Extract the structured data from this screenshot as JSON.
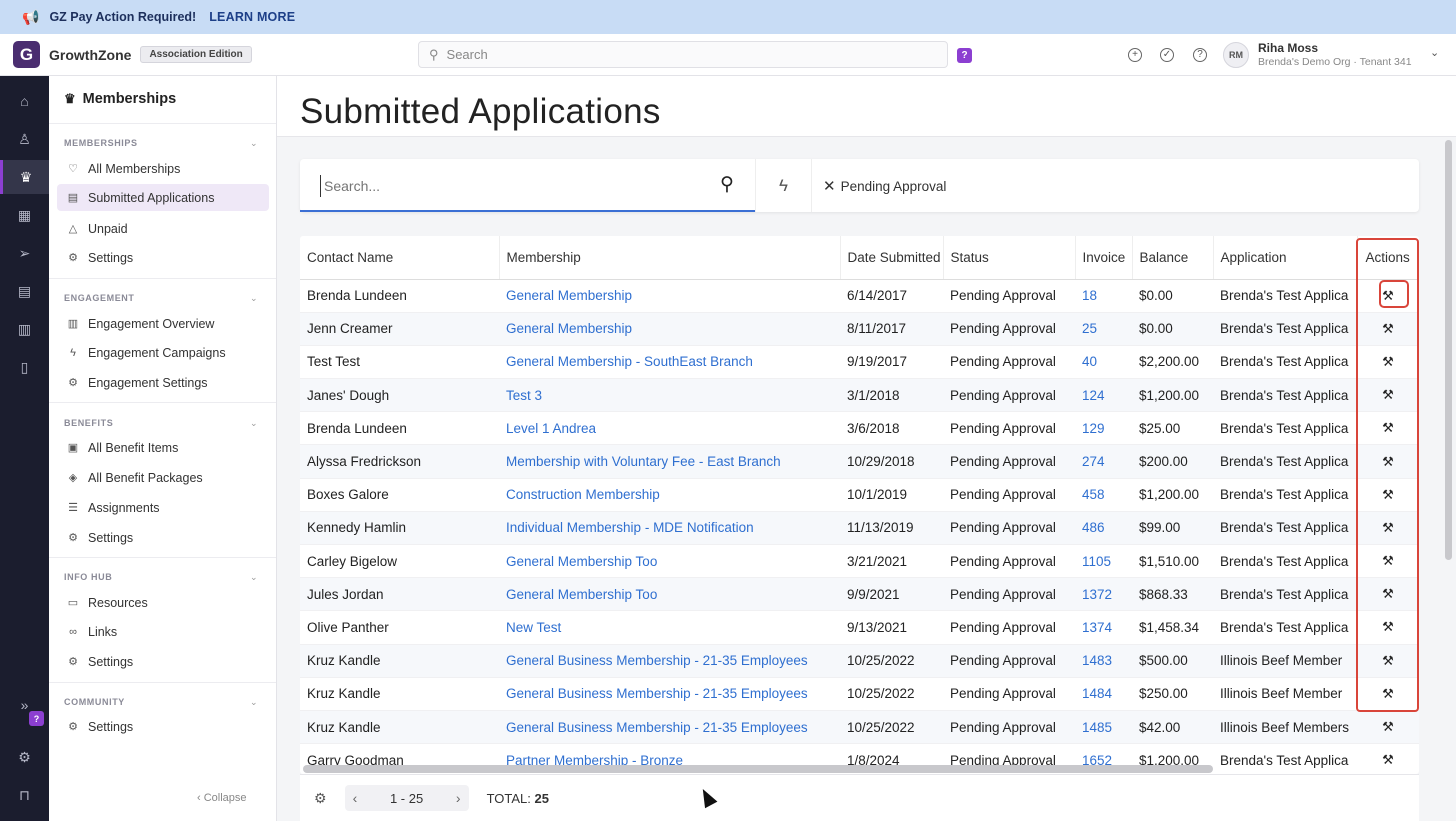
{
  "banner": {
    "text": "GZ Pay Action Required!",
    "link": "LEARN MORE"
  },
  "topbar": {
    "logo": "G",
    "brand": "GrowthZone",
    "edition": "Association Edition",
    "search_placeholder": "Search",
    "help_badge": "?",
    "user_initials": "RM",
    "user_name": "Riha Moss",
    "user_org": "Brenda's Demo Org · Tenant 341"
  },
  "rail": {
    "help_badge": "?"
  },
  "sidebar": {
    "title": "Memberships",
    "collapse": "Collapse",
    "sections": [
      {
        "header": "MEMBERSHIPS",
        "items": [
          {
            "icon": "heart-icon",
            "glyph": "♡",
            "label": "All Memberships"
          },
          {
            "icon": "document-icon",
            "glyph": "▤",
            "label": "Submitted Applications"
          },
          {
            "icon": "warning-icon",
            "glyph": "△",
            "label": "Unpaid"
          },
          {
            "icon": "gear-icon",
            "glyph": "⚙",
            "label": "Settings"
          }
        ]
      },
      {
        "header": "ENGAGEMENT",
        "items": [
          {
            "icon": "bar-chart-icon",
            "glyph": "▥",
            "label": "Engagement Overview"
          },
          {
            "icon": "lightning-icon",
            "glyph": "ϟ",
            "label": "Engagement Campaigns"
          },
          {
            "icon": "gear-icon",
            "glyph": "⚙",
            "label": "Engagement Settings"
          }
        ]
      },
      {
        "header": "BENEFITS",
        "items": [
          {
            "icon": "gift-icon",
            "glyph": "▣",
            "label": "All Benefit Items"
          },
          {
            "icon": "package-icon",
            "glyph": "◈",
            "label": "All Benefit Packages"
          },
          {
            "icon": "checklist-icon",
            "glyph": "☰",
            "label": "Assignments"
          },
          {
            "icon": "gear-icon",
            "glyph": "⚙",
            "label": "Settings"
          }
        ]
      },
      {
        "header": "INFO HUB",
        "items": [
          {
            "icon": "folder-icon",
            "glyph": "▭",
            "label": "Resources"
          },
          {
            "icon": "link-icon",
            "glyph": "∞",
            "label": "Links"
          },
          {
            "icon": "gear-icon",
            "glyph": "⚙",
            "label": "Settings"
          }
        ]
      },
      {
        "header": "COMMUNITY",
        "items": [
          {
            "icon": "gear-icon",
            "glyph": "⚙",
            "label": "Settings"
          }
        ]
      }
    ]
  },
  "main": {
    "title": "Submitted Applications",
    "search_placeholder": "Search...",
    "filter_chip": "Pending Approval",
    "columns": [
      "Contact Name",
      "Membership",
      "Date Submitted",
      "Status",
      "Invoice",
      "Balance",
      "Application",
      "Actions"
    ],
    "rows": [
      [
        "Brenda Lundeen",
        "General Membership",
        "6/14/2017",
        "Pending Approval",
        "18",
        "$0.00",
        "Brenda's Test Applica"
      ],
      [
        "Jenn Creamer",
        "General Membership",
        "8/11/2017",
        "Pending Approval",
        "25",
        "$0.00",
        "Brenda's Test Applica"
      ],
      [
        "Test Test",
        "General Membership - SouthEast Branch",
        "9/19/2017",
        "Pending Approval",
        "40",
        "$2,200.00",
        "Brenda's Test Applica"
      ],
      [
        "Janes' Dough",
        "Test 3",
        "3/1/2018",
        "Pending Approval",
        "124",
        "$1,200.00",
        "Brenda's Test Applica"
      ],
      [
        "Brenda Lundeen",
        "Level 1 Andrea",
        "3/6/2018",
        "Pending Approval",
        "129",
        "$25.00",
        "Brenda's Test Applica"
      ],
      [
        "Alyssa Fredrickson",
        "Membership with Voluntary Fee - East Branch",
        "10/29/2018",
        "Pending Approval",
        "274",
        "$200.00",
        "Brenda's Test Applica"
      ],
      [
        "Boxes Galore",
        "Construction Membership",
        "10/1/2019",
        "Pending Approval",
        "458",
        "$1,200.00",
        "Brenda's Test Applica"
      ],
      [
        "Kennedy Hamlin",
        "Individual Membership - MDE Notification",
        "11/13/2019",
        "Pending Approval",
        "486",
        "$99.00",
        "Brenda's Test Applica"
      ],
      [
        "Carley Bigelow",
        "General Membership Too",
        "3/21/2021",
        "Pending Approval",
        "1105",
        "$1,510.00",
        "Brenda's Test Applica"
      ],
      [
        "Jules Jordan",
        "General Membership Too",
        "9/9/2021",
        "Pending Approval",
        "1372",
        "$868.33",
        "Brenda's Test Applica"
      ],
      [
        "Olive Panther",
        "New Test",
        "9/13/2021",
        "Pending Approval",
        "1374",
        "$1,458.34",
        "Brenda's Test Applica"
      ],
      [
        "Kruz Kandle",
        "General Business Membership - 21-35 Employees",
        "10/25/2022",
        "Pending Approval",
        "1483",
        "$500.00",
        "Illinois Beef Member"
      ],
      [
        "Kruz Kandle",
        "General Business Membership - 21-35 Employees",
        "10/25/2022",
        "Pending Approval",
        "1484",
        "$250.00",
        "Illinois Beef Member"
      ],
      [
        "Kruz Kandle",
        "General Business Membership - 21-35 Employees",
        "10/25/2022",
        "Pending Approval",
        "1485",
        "$42.00",
        "Illinois Beef Members"
      ],
      [
        "Garry Goodman",
        "Partner Membership - Bronze",
        "1/8/2024",
        "Pending Approval",
        "1652",
        "$1,200.00",
        "Brenda's Test Applica"
      ]
    ],
    "pager": {
      "range": "1 - 25",
      "total_label": "TOTAL:",
      "total": "25"
    }
  }
}
